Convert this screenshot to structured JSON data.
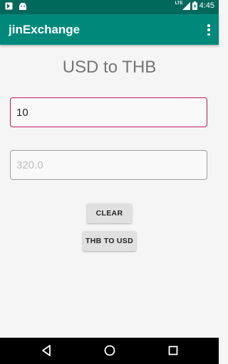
{
  "status_bar": {
    "time": "4:45",
    "network": "LTE",
    "icons": [
      "notification-icon",
      "android-icon",
      "signal-icon",
      "battery-icon"
    ]
  },
  "app_bar": {
    "title": "jinExchange",
    "menu_icon": "overflow-menu-icon"
  },
  "main": {
    "heading": "USD to THB",
    "usd_input": {
      "value": "10",
      "placeholder": ""
    },
    "thb_input": {
      "value": "",
      "placeholder": "320.0"
    },
    "clear_label": "CLEAR",
    "swap_label": "THB TO USD"
  },
  "nav_bar": {
    "items": [
      "back-icon",
      "home-icon",
      "recents-icon"
    ]
  },
  "colors": {
    "primary": "#00897b",
    "primary_dark": "#00695c",
    "accent": "#c2185b"
  }
}
